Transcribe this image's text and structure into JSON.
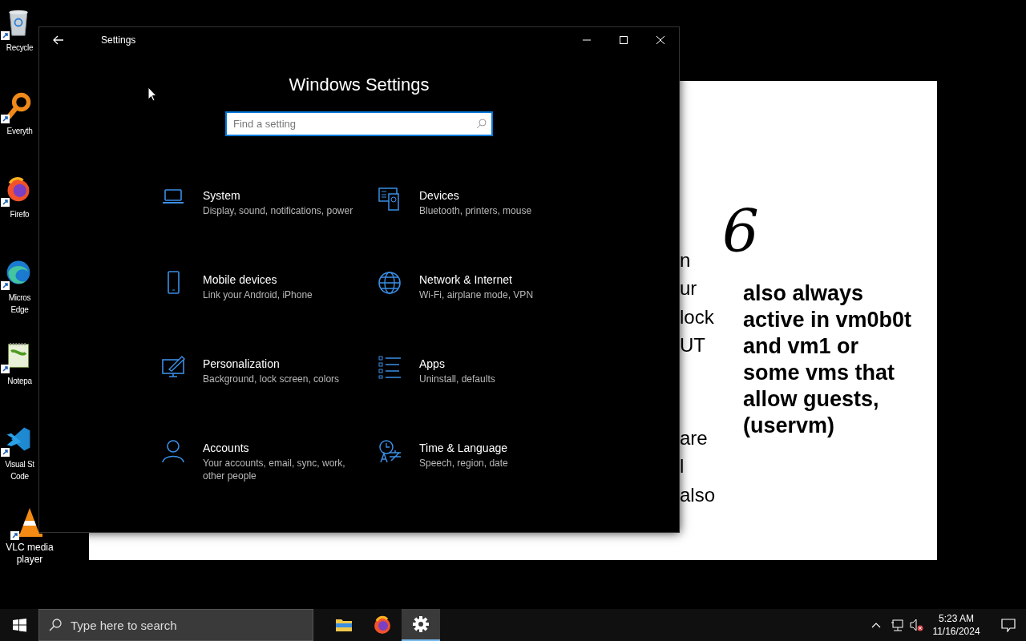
{
  "desktop_icons": [
    {
      "kind": "recycle-bin",
      "lines": [
        "Recycle"
      ]
    },
    {
      "kind": "magnifier",
      "lines": [
        "Everyth"
      ]
    },
    {
      "kind": "fox-browser",
      "lines": [
        "Firefo"
      ]
    },
    {
      "kind": "wave-browser",
      "lines": [
        "Micros",
        "Edge"
      ]
    },
    {
      "kind": "notepad",
      "lines": [
        "Notepa"
      ]
    },
    {
      "kind": "code-editor",
      "lines": [
        "Visual St",
        "Code"
      ]
    },
    {
      "kind": "cone",
      "lines": [
        "VLC media",
        "player"
      ]
    }
  ],
  "document": {
    "fragments": [
      "n",
      "ur",
      "lock",
      "UT",
      "are",
      "l",
      "also"
    ],
    "handwriting": "6",
    "note_lines": [
      "also always",
      "active in vm0b0t",
      "and vm1 or",
      "some vms that",
      "allow guests,",
      "(uservm)"
    ]
  },
  "settings": {
    "title": "Settings",
    "heading": "Windows Settings",
    "search": {
      "placeholder": "Find a setting"
    },
    "categories": [
      {
        "kind": "laptop",
        "title": "System",
        "description": "Display, sound, notifications, power"
      },
      {
        "kind": "devices",
        "title": "Devices",
        "description": "Bluetooth, printers, mouse"
      },
      {
        "kind": "phone",
        "title": "Mobile devices",
        "description": "Link your Android, iPhone"
      },
      {
        "kind": "globe",
        "title": "Network & Internet",
        "description": "Wi-Fi, airplane mode, VPN"
      },
      {
        "kind": "paint",
        "title": "Personalization",
        "description": "Background, lock screen, colors"
      },
      {
        "kind": "list",
        "title": "Apps",
        "description": "Uninstall, defaults"
      },
      {
        "kind": "person",
        "title": "Accounts",
        "description": "Your accounts, email, sync, work, other people"
      },
      {
        "kind": "clock-lang",
        "title": "Time & Language",
        "description": "Speech, region, date"
      }
    ]
  },
  "taskbar": {
    "search": {
      "placeholder": "Type here to search"
    },
    "apps": [
      {
        "kind": "folder",
        "selected": false
      },
      {
        "kind": "fox-browser",
        "selected": false
      },
      {
        "kind": "gear",
        "selected": true
      }
    ],
    "time": "5:23 AM",
    "date": "11/16/2024"
  }
}
